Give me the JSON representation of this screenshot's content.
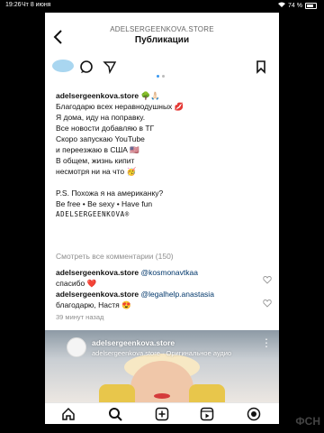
{
  "status_bar": {
    "time": "19:26",
    "date": "Чт 8 июня",
    "battery": "74 %"
  },
  "header": {
    "username": "ADELSERGEENKOVA.STORE",
    "title": "Публикации"
  },
  "caption": {
    "username": "adelsergeenkova.store",
    "username_emoji": "🌳🙏🏻",
    "lines": [
      "Благодарю всех неравнодушных 💋",
      "Я дома, иду на поправку.",
      "Все новости добавляю в ТГ",
      "Скоро запускаю YouTube",
      "и переезжаю в США 🇺🇸",
      "В общем, жизнь кипит",
      "несмотря ни на что 🥳"
    ],
    "ps_lines": [
      "P.S. Похожа я на американку?",
      "Be free • Be sexy • Have fun"
    ],
    "signature": "ADELSERGEENKOVA®"
  },
  "view_all_comments": "Смотреть все комментарии (150)",
  "comments": [
    {
      "username": "adelsergeenkova.store",
      "mention": "@kosmonavtkaa",
      "text": "спасибо ❤️"
    },
    {
      "username": "adelsergeenkova.store",
      "mention": "@legalhelp.anastasia",
      "text": "благодарю, Настя 😍"
    }
  ],
  "time_ago": "39 минут назад",
  "next_post": {
    "username": "adelsergeenkova.store",
    "subtitle": "adelsergeenkova.store · Оригинальное аудио"
  },
  "watermark": "ФСН",
  "colors": {
    "accent": "#3897f0",
    "mention": "#00376b",
    "heart_red": "#ed4956"
  },
  "icons": [
    "back-arrow-icon",
    "heart-icon",
    "comment-icon",
    "share-icon",
    "bookmark-icon",
    "home-icon",
    "search-icon",
    "add-icon",
    "reels-icon",
    "profile-icon"
  ]
}
